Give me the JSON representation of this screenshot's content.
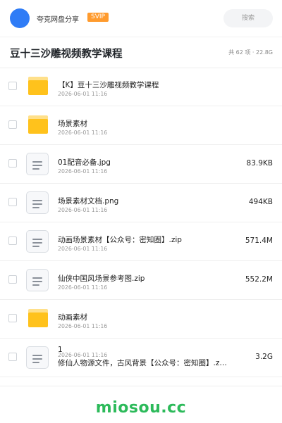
{
  "header": {
    "share_label": "夸克网盘分享",
    "badge": "SVIP",
    "search_placeholder": "搜索"
  },
  "title_bar": {
    "title": "豆十三沙雕视频教学课程",
    "summary": "共 62 项 · 22.8G"
  },
  "files": [
    {
      "type": "folder",
      "name": "【K】豆十三沙雕视频教学课程",
      "date": "2026-06-01 11:16",
      "size": ""
    },
    {
      "type": "folder",
      "name": "场景素材",
      "date": "2026-06-01 11:16",
      "size": ""
    },
    {
      "type": "file",
      "name": "01配音必备.jpg",
      "date": "2026-06-01 11:16",
      "size": "83.9KB"
    },
    {
      "type": "file",
      "name": "场景素材文档.png",
      "date": "2026-06-01 11:16",
      "size": "494KB"
    },
    {
      "type": "file",
      "name": "动画场景素材【公众号：密知圈】.zip",
      "date": "2026-06-01 11:16",
      "size": "571.4M"
    },
    {
      "type": "file",
      "name": "仙侠中国风场景参考图.zip",
      "date": "2026-06-01 11:16",
      "size": "552.2M"
    },
    {
      "type": "folder",
      "name": "动画素材",
      "date": "2026-06-01 11:16",
      "size": ""
    },
    {
      "type": "file",
      "name": "1",
      "date": "2026-06-01 11:16",
      "desc": "修仙人物源文件，古风背景【公众号：密知圈】.z…",
      "size": "3.2G"
    }
  ],
  "colors": {
    "avatar": "#2f7cf6",
    "badge": "#ff9b2e",
    "folder": "#ffc21c",
    "watermark": "#2cba5a"
  },
  "watermark": "miosou.cc"
}
